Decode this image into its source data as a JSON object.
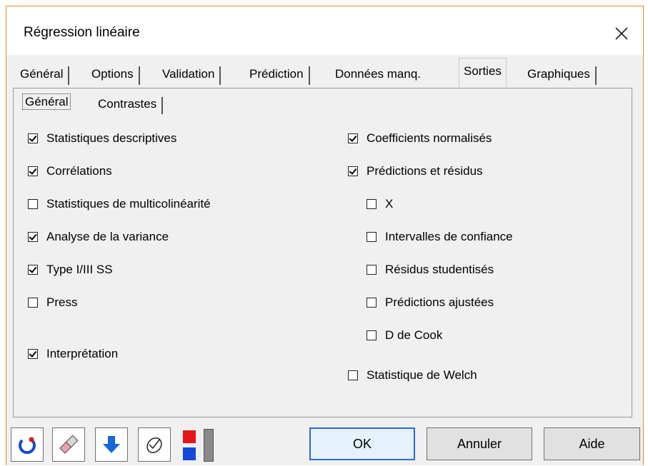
{
  "window": {
    "title": "Régression linéaire"
  },
  "tabs": [
    {
      "label": "Général",
      "active": false
    },
    {
      "label": "Options",
      "active": false
    },
    {
      "label": "Validation",
      "active": false
    },
    {
      "label": "Prédiction",
      "active": false
    },
    {
      "label": "Données manq.",
      "active": false
    },
    {
      "label": "Sorties",
      "active": true
    },
    {
      "label": "Graphiques",
      "active": false
    }
  ],
  "subtabs": [
    {
      "label": "Général",
      "active": true
    },
    {
      "label": "Contrastes",
      "active": false
    }
  ],
  "left_options": [
    {
      "label": "Statistiques descriptives",
      "checked": true
    },
    {
      "label": "Corrélations",
      "checked": true
    },
    {
      "label": "Statistiques de multicolinéarité",
      "checked": false
    },
    {
      "label": "Analyse de la variance",
      "checked": true
    },
    {
      "label": "Type I/III SS",
      "checked": true
    },
    {
      "label": "Press",
      "checked": false
    },
    {
      "label": "Interprétation",
      "checked": true
    }
  ],
  "right_options": [
    {
      "label": "Coefficients normalisés",
      "checked": true
    },
    {
      "label": "Prédictions et résidus",
      "checked": true
    },
    {
      "label": "X",
      "checked": false
    },
    {
      "label": "Intervalles de confiance",
      "checked": false
    },
    {
      "label": "Résidus studentisés",
      "checked": false
    },
    {
      "label": "Prédictions ajustées",
      "checked": false
    },
    {
      "label": "D de Cook",
      "checked": false
    },
    {
      "label": "Statistique de Welch",
      "checked": false
    }
  ],
  "toolbar": {
    "icons": [
      "reset-icon",
      "eraser-icon",
      "down-arrow-icon",
      "mouse-select-icon",
      "color-swatch-icon"
    ],
    "ok_label": "OK",
    "cancel_label": "Annuler",
    "help_label": "Aide"
  },
  "colors": {
    "window_border": "#e58a2e",
    "swatch_top": "#e8141c",
    "swatch_bottom": "#1448d8",
    "arrow_blue": "#1468d8"
  }
}
